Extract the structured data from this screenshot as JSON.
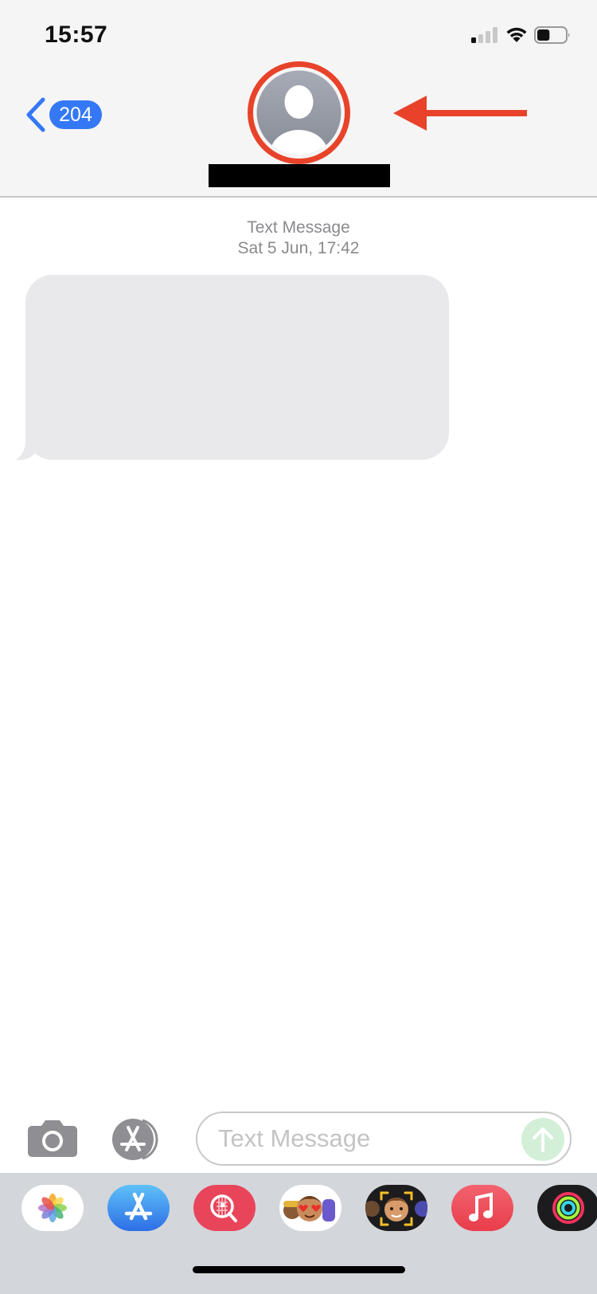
{
  "status_bar": {
    "time": "15:57",
    "signal_bars_active": 1,
    "signal_bars_total": 4,
    "battery_level": 0.45,
    "icons": [
      "cellular-signal-icon",
      "wifi-icon",
      "battery-icon"
    ]
  },
  "header": {
    "back_badge_count": "204",
    "back_icon": "chevron-left-icon",
    "contact_avatar_icon": "person-silhouette-icon",
    "contact_name_redacted": true,
    "annotation": "red circle and arrow highlighting the contact avatar"
  },
  "conversation": {
    "service_label": "Text Message",
    "timestamp": "Sat 5 Jun, 17:42",
    "messages": [
      {
        "direction": "incoming",
        "text": ""
      }
    ]
  },
  "composer": {
    "camera_icon": "camera-icon",
    "apps_icon": "app-store-icon",
    "placeholder": "Text Message",
    "value": "",
    "send_icon": "arrow-up-icon"
  },
  "app_drawer": {
    "apps": [
      {
        "name": "Photos",
        "icon": "photos-icon"
      },
      {
        "name": "App Store",
        "icon": "app-store-icon"
      },
      {
        "name": "Images Search",
        "icon": "globe-search-icon"
      },
      {
        "name": "Memoji Stickers",
        "icon": "memoji-stickers-icon"
      },
      {
        "name": "Memoji",
        "icon": "memoji-icon"
      },
      {
        "name": "Music",
        "icon": "music-note-icon"
      },
      {
        "name": "Activity",
        "icon": "activity-rings-icon"
      }
    ]
  },
  "colors": {
    "accent_blue": "#3478f6",
    "annotation_red": "#e8432a",
    "bubble_gray": "#e9e9eb",
    "send_disabled_green": "#d3efd8",
    "drawer_bg": "#d3d6db"
  }
}
